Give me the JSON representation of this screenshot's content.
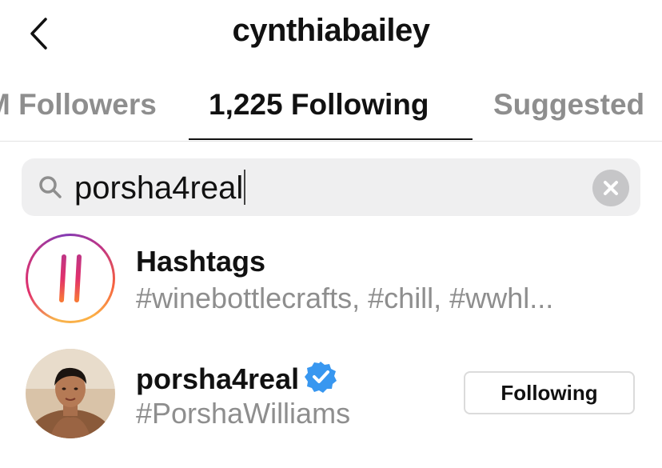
{
  "header": {
    "title": "cynthiabailey",
    "back_icon": "chevron-left-icon"
  },
  "tabs": [
    {
      "label": "M Followers",
      "active": false
    },
    {
      "label": "1,225 Following",
      "active": true
    },
    {
      "label": "Suggested",
      "active": false
    }
  ],
  "search": {
    "value": "porsha4real",
    "search_icon": "search-icon",
    "clear_icon": "clear-icon"
  },
  "results": [
    {
      "type": "hashtags",
      "title": "Hashtags",
      "subtitle": "#winebottlecrafts, #chill, #wwhl...",
      "icon": "hashtag-icon"
    },
    {
      "type": "account",
      "username": "porsha4real",
      "verified": true,
      "subtitle": "#PorshaWilliams",
      "button_label": "Following"
    }
  ],
  "colors": {
    "text_primary": "#111111",
    "text_secondary": "#8e8e8e",
    "search_bg": "#efeff0",
    "verified_blue": "#3897f0",
    "divider": "#dbdbdb"
  }
}
